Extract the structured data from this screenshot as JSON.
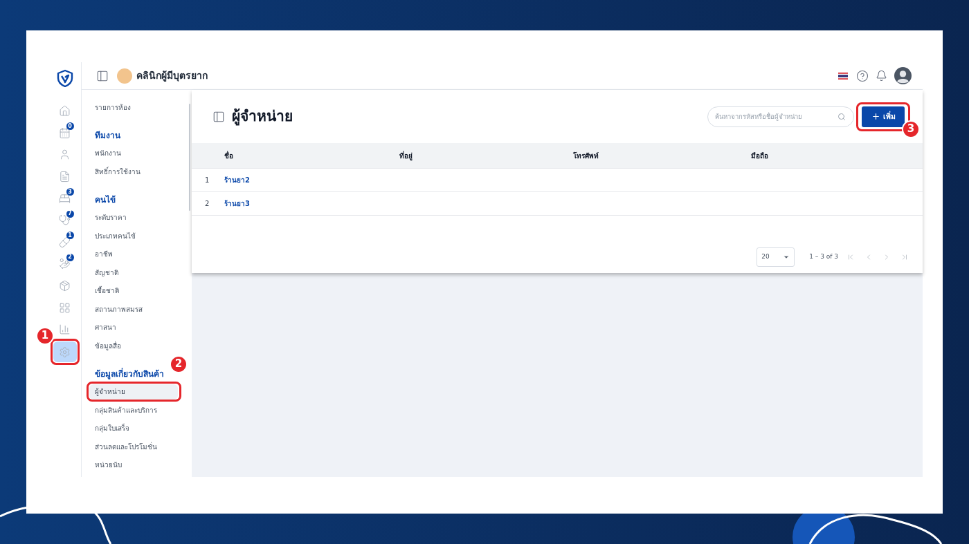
{
  "header": {
    "title": "คลินิกผู้มีบุตรยาก"
  },
  "rail": [
    {
      "kind": "home",
      "selected": false
    },
    {
      "kind": "calendar",
      "selected": false,
      "badge": "0"
    },
    {
      "kind": "user",
      "selected": false
    },
    {
      "kind": "document",
      "selected": false
    },
    {
      "kind": "bed",
      "selected": false,
      "badge": "3"
    },
    {
      "kind": "stethoscope",
      "selected": false,
      "badge": "7"
    },
    {
      "kind": "pill",
      "selected": false,
      "badge": "1"
    },
    {
      "kind": "hand",
      "selected": false,
      "badge": "2"
    },
    {
      "kind": "box",
      "selected": false
    },
    {
      "kind": "grid",
      "selected": false
    },
    {
      "kind": "chart",
      "selected": false
    },
    {
      "kind": "settings",
      "selected": true,
      "callout": "1"
    }
  ],
  "sidebar": {
    "sections": [
      {
        "items": [
          {
            "label": "รายการห้อง",
            "selected": false
          }
        ]
      },
      {
        "heading": "ทีมงาน",
        "items": [
          {
            "label": "พนักงาน",
            "selected": false
          },
          {
            "label": "สิทธิ์การใช้งาน",
            "selected": false
          }
        ]
      },
      {
        "heading": "คนไข้",
        "items": [
          {
            "label": "ระดับราคา",
            "selected": false
          },
          {
            "label": "ประเภทคนไข้",
            "selected": false
          },
          {
            "label": "อาชีพ",
            "selected": false
          },
          {
            "label": "สัญชาติ",
            "selected": false
          },
          {
            "label": "เชื้อชาติ",
            "selected": false
          },
          {
            "label": "สถานภาพสมรส",
            "selected": false
          },
          {
            "label": "ศาสนา",
            "selected": false
          },
          {
            "label": "ข้อมูลสื่อ",
            "selected": false
          }
        ]
      },
      {
        "heading": "ข้อมูลเกี่ยวกับสินค้า",
        "items": [
          {
            "label": "ผู้จำหน่าย",
            "selected": true,
            "callout": "2"
          },
          {
            "label": "กลุ่มสินค้าและบริการ",
            "selected": false
          },
          {
            "label": "กลุ่มใบเสร็จ",
            "selected": false
          },
          {
            "label": "ส่วนลดและโปรโมชั่น",
            "selected": false
          },
          {
            "label": "หน่วยนับ",
            "selected": false
          }
        ]
      }
    ]
  },
  "page": {
    "title": "ผู้จำหน่าย",
    "search": {
      "placeholder": "ค้นหาจากรหัสหรือชื่อผู้จำหน่าย"
    },
    "add_button": {
      "label": "เพิ่ม",
      "callout": "3"
    }
  },
  "table": {
    "columns": [
      "ชื่อ",
      "ที่อยู่",
      "โทรศัพท์",
      "มือถือ"
    ],
    "rows": [
      {
        "index": "1",
        "name": "ร้านยา2"
      },
      {
        "index": "2",
        "name": "ร้านยา3"
      }
    ]
  },
  "pagination": {
    "page_size": "20",
    "range": "1 – 3 of 3"
  }
}
